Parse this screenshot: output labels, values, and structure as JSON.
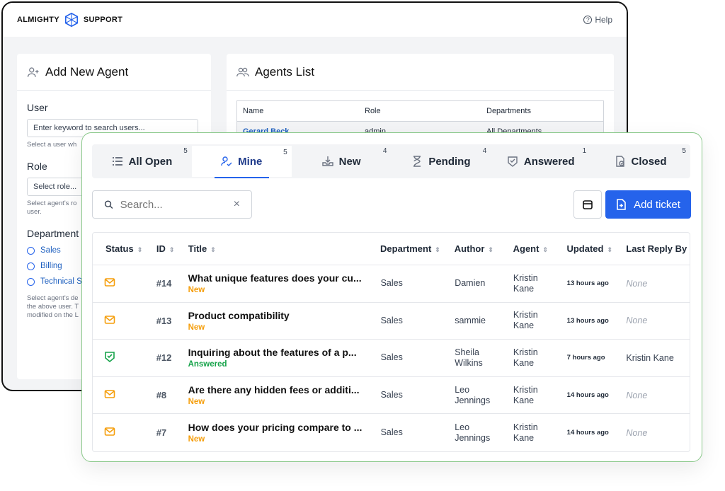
{
  "colors": {
    "accent": "#2563eb",
    "new": "#f59e0b",
    "answered": "#16a34a",
    "frame": "#8bc98b"
  },
  "back": {
    "brand_left": "ALMIGHTY",
    "brand_right": "SUPPORT",
    "help_label": "Help",
    "add_agent": {
      "title": "Add New Agent",
      "user_label": "User",
      "user_placeholder": "Enter keyword to search users...",
      "user_help": "Select a user wh",
      "role_label": "Role",
      "role_value": "Select role...",
      "role_help_1": "Select agent's ro",
      "role_help_2": "user.",
      "dept_label": "Department",
      "departments": [
        "Sales",
        "Billing",
        "Technical S"
      ],
      "dept_help_1": "Select agent's de",
      "dept_help_2": "the above user. T",
      "dept_help_3": "modified on the L"
    },
    "agents_list": {
      "title": "Agents List",
      "columns": [
        "Name",
        "Role",
        "Departments"
      ],
      "rows": [
        {
          "name": "Gerard Beck",
          "role": "admin",
          "departments": "All Departments"
        }
      ]
    }
  },
  "tabs": [
    {
      "label": "All Open",
      "count": "5",
      "icon": "list-icon"
    },
    {
      "label": "Mine",
      "count": "5",
      "icon": "user-check-icon"
    },
    {
      "label": "New",
      "count": "4",
      "icon": "inbox-icon"
    },
    {
      "label": "Pending",
      "count": "4",
      "icon": "hourglass-icon"
    },
    {
      "label": "Answered",
      "count": "1",
      "icon": "check-badge-icon"
    },
    {
      "label": "Closed",
      "count": "5",
      "icon": "closed-doc-icon"
    }
  ],
  "active_tab": "Mine",
  "search": {
    "placeholder": "Search..."
  },
  "add_ticket_label": "Add ticket",
  "table": {
    "columns": [
      "Status",
      "ID",
      "Title",
      "Department",
      "Author",
      "Agent",
      "Updated",
      "Last Reply By"
    ],
    "rows": [
      {
        "id": "#14",
        "title": "What unique features does your cu...",
        "state": "New",
        "department": "Sales",
        "author": "Damien",
        "agent_1": "Kristin",
        "agent_2": "Kane",
        "updated": "13 hours ago",
        "last_reply": "None"
      },
      {
        "id": "#13",
        "title": "Product compatibility",
        "state": "New",
        "department": "Sales",
        "author": "sammie",
        "agent_1": "Kristin",
        "agent_2": "Kane",
        "updated": "13 hours ago",
        "last_reply": "None"
      },
      {
        "id": "#12",
        "title": "Inquiring about the features of a p...",
        "state": "Answered",
        "department": "Sales",
        "author": "Sheila Wilkins",
        "agent_1": "Kristin",
        "agent_2": "Kane",
        "updated": "7 hours ago",
        "last_reply": "Kristin Kane"
      },
      {
        "id": "#8",
        "title": "Are there any hidden fees or additi...",
        "state": "New",
        "department": "Sales",
        "author": "Leo Jennings",
        "agent_1": "Kristin",
        "agent_2": "Kane",
        "updated": "14 hours ago",
        "last_reply": "None"
      },
      {
        "id": "#7",
        "title": "How does your pricing compare to ...",
        "state": "New",
        "department": "Sales",
        "author": "Leo Jennings",
        "agent_1": "Kristin",
        "agent_2": "Kane",
        "updated": "14 hours ago",
        "last_reply": "None"
      }
    ]
  }
}
